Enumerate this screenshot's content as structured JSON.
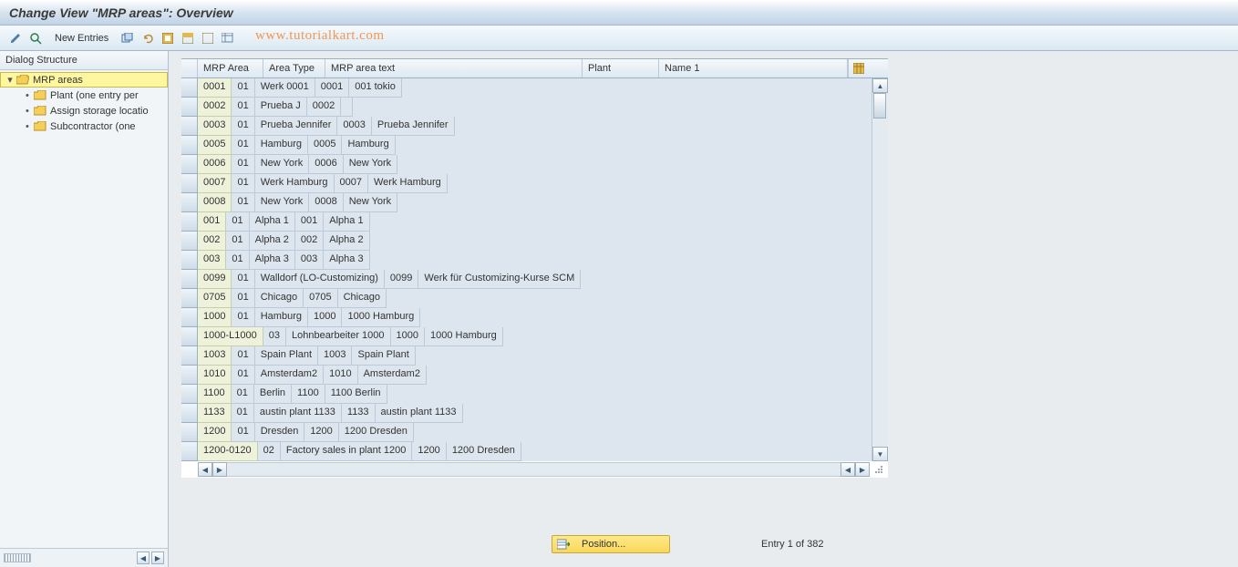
{
  "title": "Change View \"MRP areas\": Overview",
  "toolbar": {
    "new_entries_label": "New Entries"
  },
  "watermark": "www.tutorialkart.com",
  "sidebar": {
    "header": "Dialog Structure",
    "root_label": "MRP areas",
    "children": [
      "Plant (one entry per",
      "Assign storage locatio",
      "Subcontractor (one"
    ]
  },
  "table": {
    "headers": {
      "c1": "MRP Area",
      "c2": "Area Type",
      "c3": "MRP area text",
      "c4": "Plant",
      "c5": "Name 1"
    },
    "rows": [
      {
        "c1": "0001",
        "c2": "01",
        "c3": "Werk 0001",
        "c4": "0001",
        "c5": "001 tokio"
      },
      {
        "c1": "0002",
        "c2": "01",
        "c3": "Prueba J",
        "c4": "0002",
        "c5": ""
      },
      {
        "c1": "0003",
        "c2": "01",
        "c3": "Prueba Jennifer",
        "c4": "0003",
        "c5": "Prueba Jennifer"
      },
      {
        "c1": "0005",
        "c2": "01",
        "c3": "Hamburg",
        "c4": "0005",
        "c5": "Hamburg"
      },
      {
        "c1": "0006",
        "c2": "01",
        "c3": "New York",
        "c4": "0006",
        "c5": "New York"
      },
      {
        "c1": "0007",
        "c2": "01",
        "c3": "Werk Hamburg",
        "c4": "0007",
        "c5": "Werk Hamburg"
      },
      {
        "c1": "0008",
        "c2": "01",
        "c3": "New York",
        "c4": "0008",
        "c5": "New York"
      },
      {
        "c1": "001",
        "c2": "01",
        "c3": "Alpha 1",
        "c4": "001",
        "c5": "Alpha 1"
      },
      {
        "c1": "002",
        "c2": "01",
        "c3": "Alpha 2",
        "c4": "002",
        "c5": "Alpha 2"
      },
      {
        "c1": "003",
        "c2": "01",
        "c3": "Alpha 3",
        "c4": "003",
        "c5": "Alpha 3"
      },
      {
        "c1": "0099",
        "c2": "01",
        "c3": "Walldorf (LO-Customizing)",
        "c4": "0099",
        "c5": "Werk für Customizing-Kurse SCM"
      },
      {
        "c1": "0705",
        "c2": "01",
        "c3": "Chicago",
        "c4": "0705",
        "c5": "Chicago"
      },
      {
        "c1": "1000",
        "c2": "01",
        "c3": "Hamburg",
        "c4": "1000",
        "c5": "1000 Hamburg"
      },
      {
        "c1": "1000-L1000",
        "c2": "03",
        "c3": "Lohnbearbeiter 1000",
        "c4": "1000",
        "c5": "1000 Hamburg"
      },
      {
        "c1": "1003",
        "c2": "01",
        "c3": "Spain Plant",
        "c4": "1003",
        "c5": "Spain Plant"
      },
      {
        "c1": "1010",
        "c2": "01",
        "c3": "Amsterdam2",
        "c4": "1010",
        "c5": "Amsterdam2"
      },
      {
        "c1": "1100",
        "c2": "01",
        "c3": "Berlin",
        "c4": "1100",
        "c5": "1100 Berlin"
      },
      {
        "c1": "1133",
        "c2": "01",
        "c3": "austin plant 1133",
        "c4": "1133",
        "c5": "austin plant 1133"
      },
      {
        "c1": "1200",
        "c2": "01",
        "c3": "Dresden",
        "c4": "1200",
        "c5": "1200 Dresden"
      },
      {
        "c1": "1200-0120",
        "c2": "02",
        "c3": "Factory sales in plant 1200",
        "c4": "1200",
        "c5": "1200 Dresden"
      }
    ]
  },
  "footer": {
    "position_label": "Position...",
    "entry_text": "Entry 1 of 382"
  }
}
